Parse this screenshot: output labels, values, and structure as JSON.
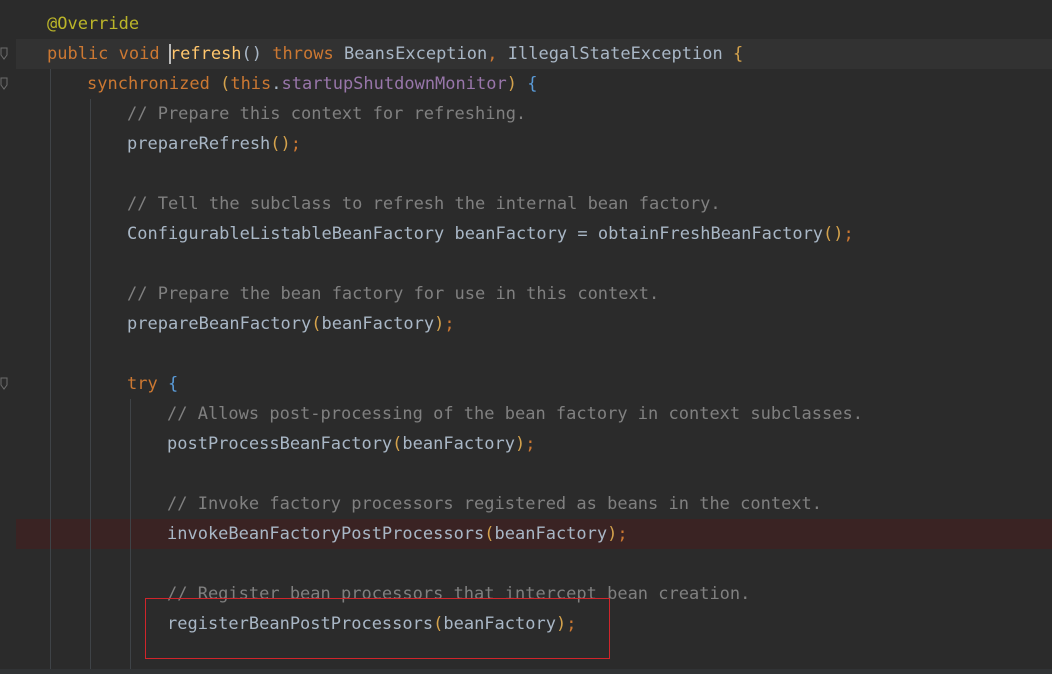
{
  "editor": {
    "language": "Java",
    "colors": {
      "background": "#2b2b2b",
      "keyword": "#cc7832",
      "annotation": "#bbb529",
      "method_declaration": "#ffc66d",
      "field": "#9876aa",
      "comment": "#808080",
      "plain": "#a9b7c6",
      "highlight_box": "#d0252b",
      "breakpoint_line": "#3a2323"
    },
    "lines": {
      "l1": {
        "annotation": "@Override"
      },
      "l2": {
        "public": "public",
        "void": "void",
        "method_a": "r",
        "method_b": "efresh",
        "paren": "()",
        "throws": "throws",
        "ex1": "BeansException",
        "comma": ",",
        "ex2": "IllegalStateException",
        "brace": "{"
      },
      "l3": {
        "synchronized": "synchronized",
        "open": "(",
        "this": "this",
        "dot": ".",
        "field": "startupShutdownMonitor",
        "close": ")",
        "brace": "{"
      },
      "l4": {
        "comment": "// Prepare this context for refreshing."
      },
      "l5": {
        "call": "prepareRefresh",
        "paren": "()",
        "semi": ";"
      },
      "l7": {
        "comment": "// Tell the subclass to refresh the internal bean factory."
      },
      "l8": {
        "type": "ConfigurableListableBeanFactory",
        "var": "beanFactory",
        "eq": "=",
        "call": "obtainFreshBeanFactory",
        "paren": "()",
        "semi": ";"
      },
      "l10": {
        "comment": "// Prepare the bean factory for use in this context."
      },
      "l11": {
        "call": "prepareBeanFactory",
        "open": "(",
        "arg": "beanFactory",
        "close": ")",
        "semi": ";"
      },
      "l13": {
        "try": "try",
        "brace": "{"
      },
      "l14": {
        "comment": "// Allows post-processing of the bean factory in context subclasses."
      },
      "l15": {
        "call": "postProcessBeanFactory",
        "open": "(",
        "arg": "beanFactory",
        "close": ")",
        "semi": ";"
      },
      "l17": {
        "comment": "// Invoke factory processors registered as beans in the context."
      },
      "l18": {
        "call": "invokeBeanFactoryPostProcessors",
        "open": "(",
        "arg": "beanFactory",
        "close": ")",
        "semi": ";"
      },
      "l20": {
        "comment": "// Register bean processors that intercept bean creation."
      },
      "l21": {
        "call": "registerBeanPostProcessors",
        "open": "(",
        "arg": "beanFactory",
        "close": ")",
        "semi": ";"
      }
    },
    "gutter_icons": [
      "fold-marker-icon",
      "fold-marker-icon",
      "fold-marker-icon"
    ]
  }
}
